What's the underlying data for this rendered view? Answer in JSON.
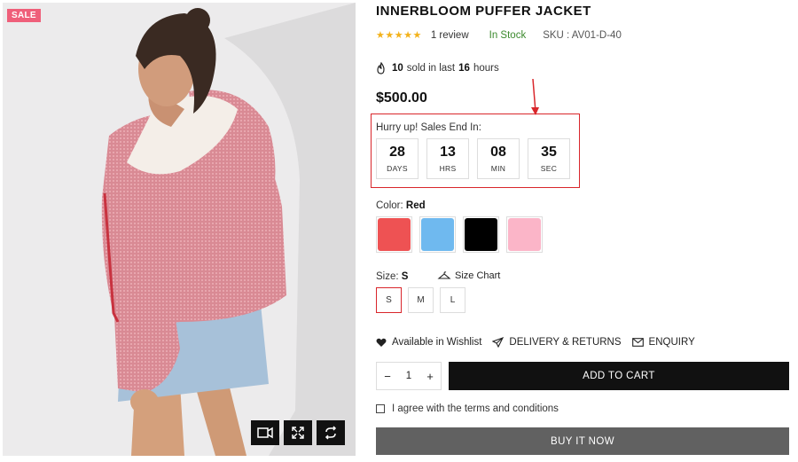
{
  "media": {
    "sale_badge": "SALE",
    "tools": [
      "video-icon",
      "expand-icon",
      "swap-icon"
    ]
  },
  "product": {
    "title": "INNERBLOOM PUFFER JACKET",
    "rating_stars": "★★★★★",
    "rating": 5,
    "reviews": "1 review",
    "stock": "In Stock",
    "sku": "SKU : AV01-D-40",
    "sold_count": "10",
    "sold_hours": "16",
    "sold_text_a": "sold in last",
    "sold_text_b": "hours",
    "price": "$500.00"
  },
  "countdown": {
    "label": "Hurry up! Sales End In:",
    "days": "28",
    "days_unit": "DAYS",
    "hrs": "13",
    "hrs_unit": "HRS",
    "min": "08",
    "min_unit": "MIN",
    "sec": "35",
    "sec_unit": "SEC"
  },
  "color": {
    "label": "Color:",
    "selected": "Red",
    "options": [
      {
        "name": "Red",
        "hex": "#ee5253"
      },
      {
        "name": "Blue",
        "hex": "#6fb9ef"
      },
      {
        "name": "Black",
        "hex": "#000000"
      },
      {
        "name": "Pink",
        "hex": "#fbb5c8"
      }
    ]
  },
  "size": {
    "label": "Size:",
    "selected": "S",
    "chart_label": "Size Chart",
    "options": [
      "S",
      "M",
      "L"
    ]
  },
  "links": {
    "wishlist": "Available in Wishlist",
    "delivery": "DELIVERY & RETURNS",
    "enquiry": "ENQUIRY"
  },
  "cart": {
    "qty_minus": "−",
    "qty_value": "1",
    "qty_plus": "+",
    "add_label": "ADD TO CART",
    "terms": "I agree with the terms and conditions",
    "buy_label": "BUY IT NOW"
  },
  "colors": {
    "highlight": "#d9262b",
    "stock": "#3c8a2e",
    "stars": "#f3b21b",
    "sale_badge": "#ef5f7a"
  }
}
